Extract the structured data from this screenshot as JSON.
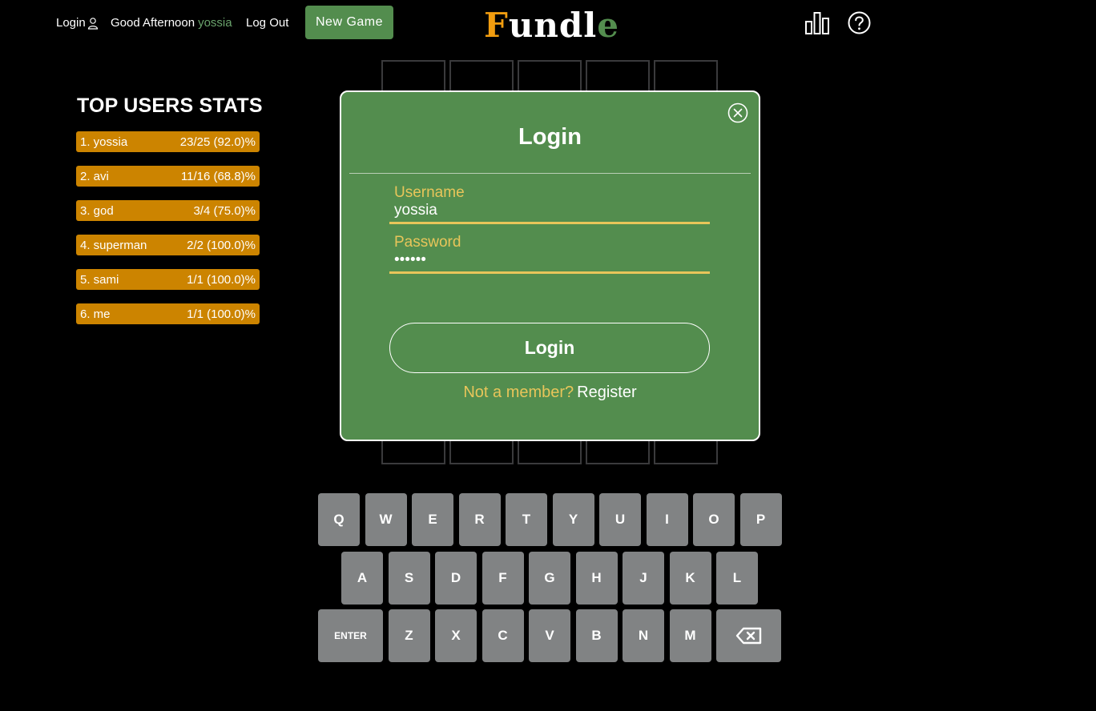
{
  "header": {
    "login_label": "Login",
    "greeting": "Good Afternoon",
    "username": "yossia",
    "logout_label": "Log Out",
    "new_game_label": "New Game",
    "logo": {
      "first": "F",
      "middle": "undl",
      "last": "e"
    },
    "icons": {
      "user": "user-icon",
      "stats": "bar-chart-icon",
      "help": "question-mark-icon"
    }
  },
  "top_users": {
    "title": "TOP USERS STATS",
    "rows": [
      {
        "name": "1. yossia",
        "score": "23/25 (92.0)%"
      },
      {
        "name": "2. avi",
        "score": "11/16 (68.8)%"
      },
      {
        "name": "3. god",
        "score": "3/4 (75.0)%"
      },
      {
        "name": "4. superman",
        "score": "2/2 (100.0)%"
      },
      {
        "name": "5. sami",
        "score": "1/1 (100.0)%"
      },
      {
        "name": "6. me",
        "score": "1/1 (100.0)%"
      }
    ]
  },
  "modal": {
    "title": "Login",
    "username_label": "Username",
    "username_value": "yossia",
    "password_label": "Password",
    "password_value": "••••••",
    "login_button": "Login",
    "not_member": "Not a member?",
    "register_link": "Register",
    "icons": {
      "close": "close-icon"
    }
  },
  "keyboard": {
    "row1": [
      "Q",
      "W",
      "E",
      "R",
      "T",
      "Y",
      "U",
      "I",
      "O",
      "P"
    ],
    "row2": [
      "A",
      "S",
      "D",
      "F",
      "G",
      "H",
      "J",
      "K",
      "L"
    ],
    "row3_enter": "ENTER",
    "row3": [
      "Z",
      "X",
      "C",
      "V",
      "B",
      "N",
      "M"
    ],
    "icons": {
      "backspace": "backspace-icon"
    }
  },
  "colors": {
    "background": "#000000",
    "green": "#538d4e",
    "orange_logo": "#f29d0f",
    "stat_row": "#cc8400",
    "field_accent": "#e8c55a",
    "key": "#818384",
    "tile_border": "#3a3a3c"
  }
}
